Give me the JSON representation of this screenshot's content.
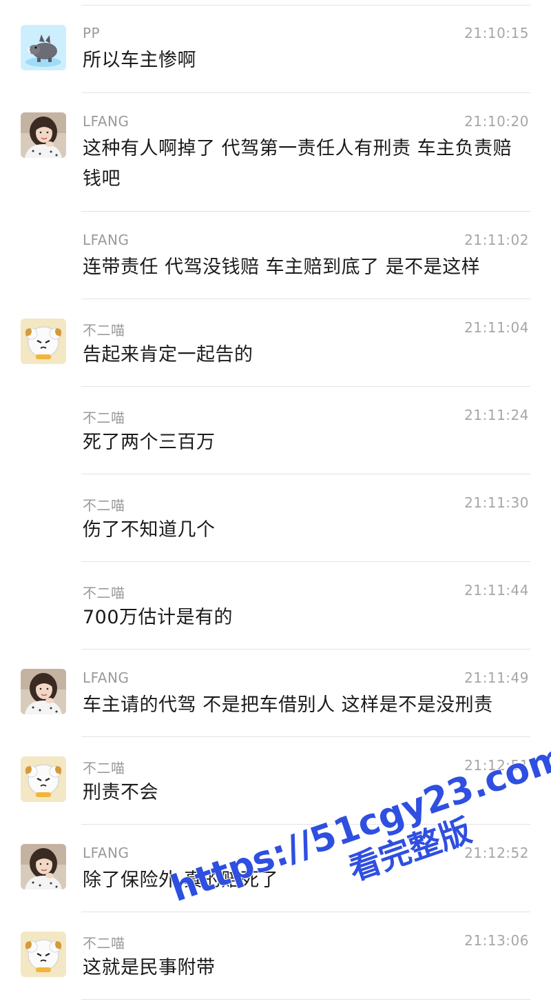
{
  "messages": [
    {
      "sender": "PP",
      "time": "21:10:15",
      "text": "所以车主惨啊",
      "avatar": "pp"
    },
    {
      "sender": "LFANG",
      "time": "21:10:20",
      "text": "这种有人啊掉了  代驾第一责任人有刑责 车主负责赔钱吧",
      "avatar": "lfang"
    },
    {
      "sender": "LFANG",
      "time": "21:11:02",
      "text": "连带责任 代驾没钱赔 车主赔到底了 是不是这样",
      "avatar": ""
    },
    {
      "sender": "不二喵",
      "time": "21:11:04",
      "text": "告起来肯定一起告的",
      "avatar": "sheep"
    },
    {
      "sender": "不二喵",
      "time": "21:11:24",
      "text": "死了两个三百万",
      "avatar": ""
    },
    {
      "sender": "不二喵",
      "time": "21:11:30",
      "text": "伤了不知道几个",
      "avatar": ""
    },
    {
      "sender": "不二喵",
      "time": "21:11:44",
      "text": "700万估计是有的",
      "avatar": ""
    },
    {
      "sender": "LFANG",
      "time": "21:11:49",
      "text": "车主请的代驾 不是把车借别人 这样是不是没刑责",
      "avatar": "lfang"
    },
    {
      "sender": "不二喵",
      "time": "21:12:51",
      "text": "刑责不会",
      "avatar": "sheep"
    },
    {
      "sender": "LFANG",
      "time": "21:12:52",
      "text": "除了保险外 真的赔死了",
      "avatar": "lfang"
    },
    {
      "sender": "不二喵",
      "time": "21:13:06",
      "text": "这就是民事附带",
      "avatar": "sheep"
    }
  ],
  "watermark": {
    "line1": "https://51cgy23.com",
    "line2": "看完整版",
    "color": "#2f4fe0"
  },
  "avatar_icons": {
    "pp": "boar-icon",
    "lfang": "girl-avatar-icon",
    "sheep": "sheep-icon"
  }
}
